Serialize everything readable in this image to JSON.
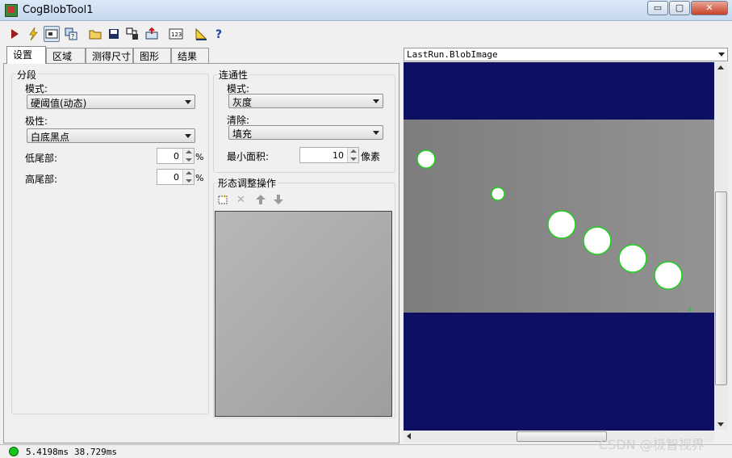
{
  "window": {
    "title": "CogBlobTool1"
  },
  "window_buttons": {
    "minimize": "▭",
    "maximize": "▢",
    "close": "✕"
  },
  "toolbar": {
    "icons": [
      "run-icon",
      "electric-icon",
      "display-icon",
      "image-tool-icon",
      "open-folder-icon",
      "save-icon",
      "export-icon",
      "import-icon",
      "numeric-icon",
      "ruler-icon",
      "help-icon"
    ]
  },
  "tabs": [
    "设置",
    "区域",
    "测得尺寸",
    "图形",
    "结果"
  ],
  "segment": {
    "title": "分段",
    "mode_label": "模式:",
    "mode_value": "硬阈值(动态)",
    "polarity_label": "极性:",
    "polarity_value": "白底黑点",
    "low_tail_label": "低尾部:",
    "low_tail_value": "0",
    "high_tail_label": "高尾部:",
    "high_tail_value": "0",
    "percent": "%"
  },
  "connectivity": {
    "title": "连通性",
    "mode_label": "模式:",
    "mode_value": "灰度",
    "cleanup_label": "清除:",
    "cleanup_value": "填充",
    "min_area_label": "最小面积:",
    "min_area_value": "10",
    "min_area_unit": "像素"
  },
  "morphology": {
    "title": "形态调整操作"
  },
  "image_view": {
    "selected": "LastRun.BlobImage",
    "colors": {
      "dark_band": "#0d0f62",
      "gray_band": "#8a8a8a",
      "blob": "#ffffff",
      "outline": "#19d319"
    }
  },
  "status": {
    "time1": "5.4198ms",
    "time2": "38.729ms"
  },
  "watermark": "CSDN @极智视界"
}
